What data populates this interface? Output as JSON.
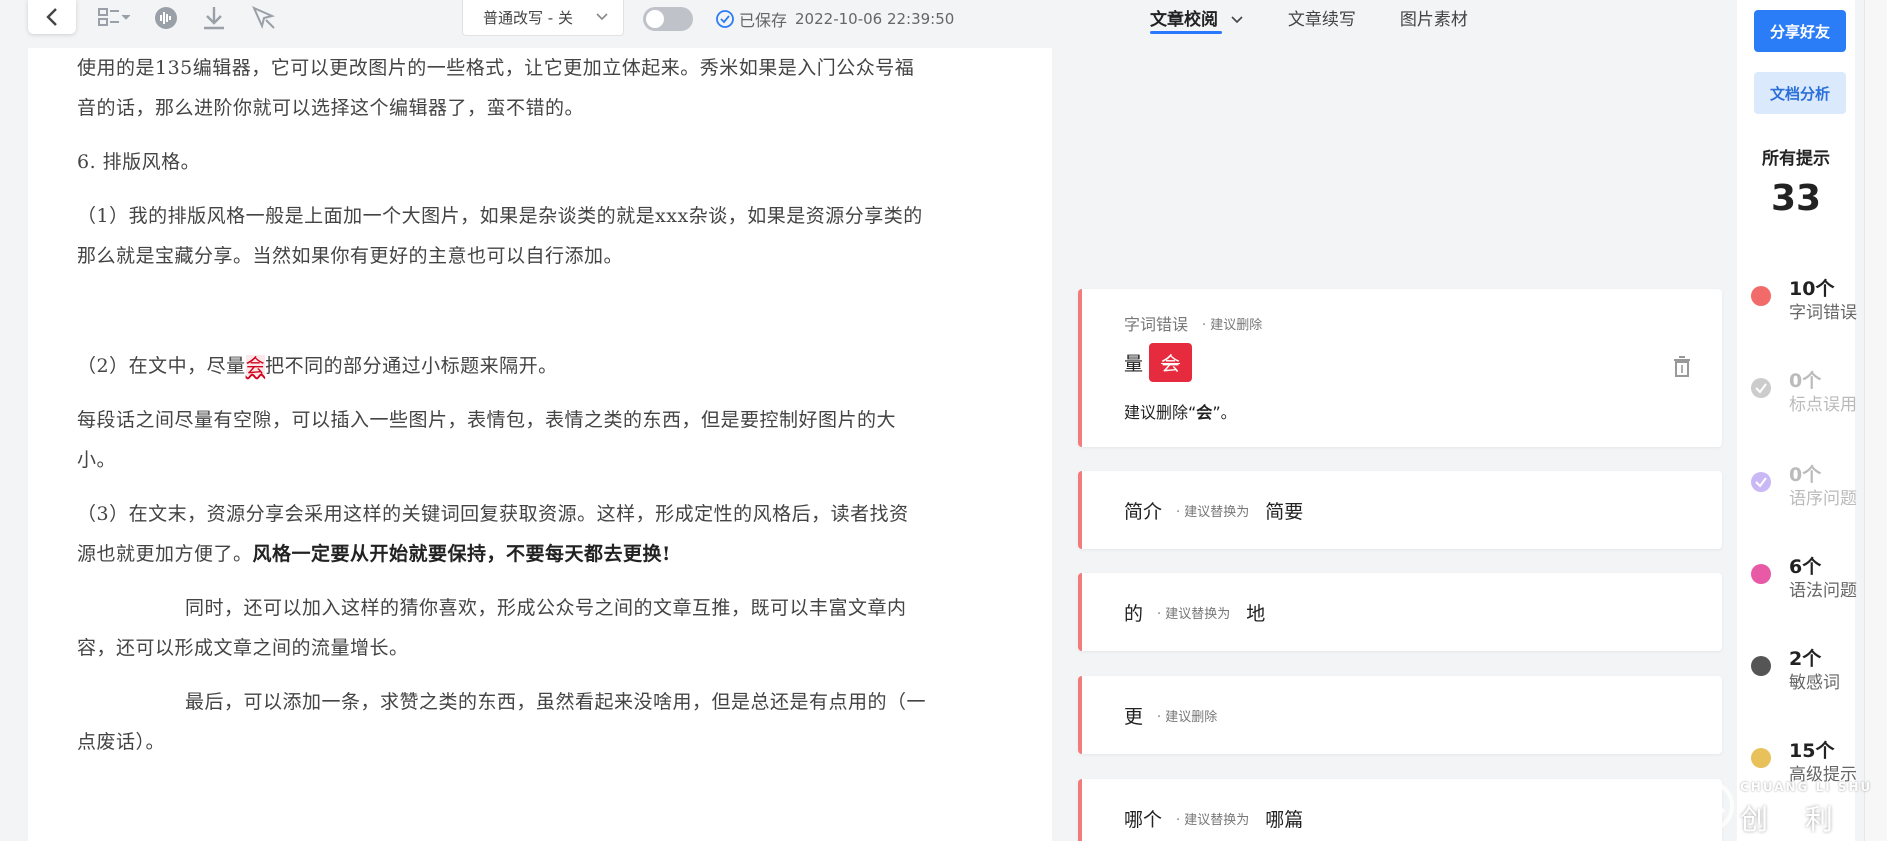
{
  "toolbar": {
    "mode_select": "普通改写 - 关",
    "saved_label": "已保存",
    "saved_time": "2022-10-06 22:39:50"
  },
  "tabs": [
    {
      "label": "文章校阅",
      "active": true
    },
    {
      "label": "文章续写",
      "active": false
    },
    {
      "label": "图片素材",
      "active": false
    }
  ],
  "document": {
    "p1a": "使用的是135编辑器，它可以更改图片的一些格式，让它更加立体起来。秀米如果是入门公众号福",
    "p1b": "音的话，那么进阶你就可以选择这个编辑器了，蛮不错的。",
    "p2": "6.   排版风格。",
    "p3a": "（1）我的排版风格一般是上面加一个大图片，如果是杂谈类的就是xxx杂谈，如果是资源分享类的",
    "p3b": "那么就是宝藏分享。当然如果你有更好的主意也可以自行添加。",
    "p4_before": "（2）在文中，尽量",
    "p4_mark": "会",
    "p4_after": "把不同的部分通过小标题来隔开。",
    "p5a": "每段话之间尽量有空隙，可以插入一些图片，表情包，表情之类的东西，但是要控制好图片的大",
    "p5b": "小。",
    "p6a": "（3）在文末，资源分享会采用这样的关键词回复获取资源。这样，形成定性的风格后，读者找资",
    "p6b_plain": "源也就更加方便了。",
    "p6b_bold": "风格一定要从开始就要保持，不要每天都去更换!",
    "p7a": "同时，还可以加入这样的猜你喜欢，形成公众号之间的文章互推，既可以丰富文章内",
    "p7b": "容，还可以形成文章之间的流量增长。",
    "p8a": "最后，可以添加一条，求赞之类的东西，虽然看起来没啥用，但是总还是有点用的（一",
    "p8b": "点废话）。"
  },
  "cards": [
    {
      "category": "字词错误",
      "hint": "· 建议删除",
      "word": "量",
      "deleted": "会",
      "advice_prefix": "建议删除“",
      "advice_word": "会",
      "advice_suffix": "”。"
    },
    {
      "word": "简介",
      "hint": "· 建议替换为",
      "replacement": "简要"
    },
    {
      "word": "的",
      "hint": "· 建议替换为",
      "replacement": "地"
    },
    {
      "word": "更",
      "hint": "· 建议删除",
      "replacement": ""
    },
    {
      "word": "哪个",
      "hint": "· 建议替换为",
      "replacement": "哪篇"
    }
  ],
  "sidebar": {
    "share_label": "分享好友",
    "analysis_label": "文档分析",
    "total_label": "所有提示",
    "total_count": "33",
    "stats": [
      {
        "count": "10个",
        "label": "字词错误",
        "color": "#f26b6b"
      },
      {
        "count": "0个",
        "label": "标点误用",
        "color": "#cccccc"
      },
      {
        "count": "0个",
        "label": "语序问题",
        "color": "#c9b8f5"
      },
      {
        "count": "6个",
        "label": "语法问题",
        "color": "#e85aa6"
      },
      {
        "count": "2个",
        "label": "敏感词",
        "color": "#555555"
      },
      {
        "count": "15个",
        "label": "高级提示",
        "color": "#e8c15a"
      }
    ]
  },
  "watermark": {
    "en": "CHUANG LI SHU",
    "cn": "创 利 树"
  }
}
